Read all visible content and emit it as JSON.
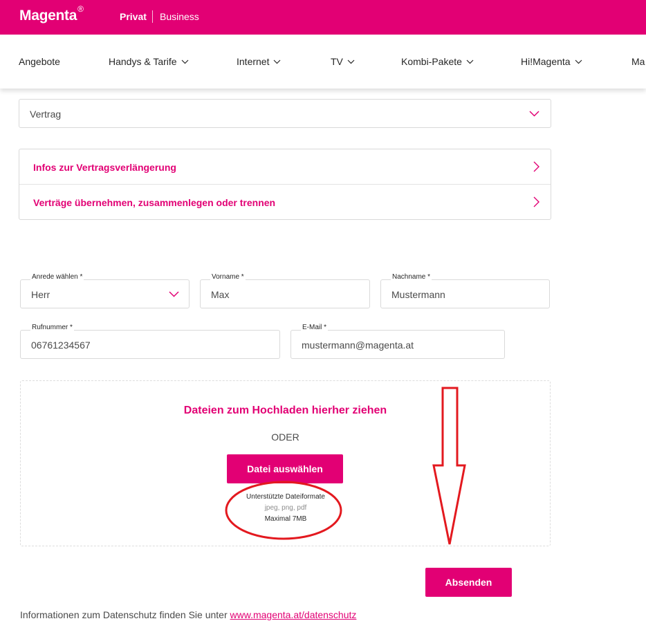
{
  "brand": {
    "name": "Magenta",
    "mark": "®",
    "accent": "#e20074",
    "annotation_color": "#e3191f"
  },
  "segments": {
    "privat": "Privat",
    "business": "Business"
  },
  "nav": [
    {
      "label": "Angebote",
      "dropdown": false
    },
    {
      "label": "Handys & Tarife",
      "dropdown": true
    },
    {
      "label": "Internet",
      "dropdown": true
    },
    {
      "label": "TV",
      "dropdown": true
    },
    {
      "label": "Kombi-Pakete",
      "dropdown": true
    },
    {
      "label": "Hi!Magenta",
      "dropdown": true
    },
    {
      "label": "Ma",
      "dropdown": false
    }
  ],
  "topic_select": {
    "value": "Vertrag",
    "icon": "chevron-down-icon"
  },
  "info_links": [
    {
      "label": "Infos zur Vertragsverlängerung",
      "icon": "chevron-right-icon"
    },
    {
      "label": "Verträge übernehmen, zusammenlegen oder trennen",
      "icon": "chevron-right-icon"
    }
  ],
  "form": {
    "salutation": {
      "label": "Anrede wählen *",
      "value": "Herr"
    },
    "first_name": {
      "label": "Vorname *",
      "value": "Max"
    },
    "last_name": {
      "label": "Nachname *",
      "value": "Mustermann"
    },
    "phone": {
      "label": "Rufnummer *",
      "value": "06761234567"
    },
    "email": {
      "label": "E-Mail *",
      "value": "mustermann@magenta.at"
    }
  },
  "upload": {
    "title": "Dateien zum Hochladen hierher ziehen",
    "or": "ODER",
    "button": "Datei auswählen",
    "formats_title": "Unterstützte Dateiformate",
    "formats": "jpeg, png, pdf",
    "max": "Maximal 7MB"
  },
  "submit": "Absenden",
  "privacy": {
    "text": "Informationen zum Datenschutz finden Sie unter",
    "link": "www.magenta.at/datenschutz"
  }
}
